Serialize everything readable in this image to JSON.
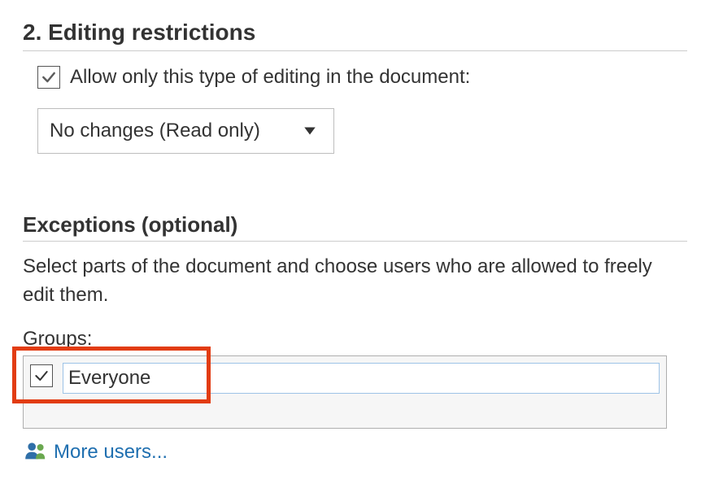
{
  "section": {
    "heading": "2. Editing restrictions",
    "allow_checkbox_label": "Allow only this type of editing in the document:",
    "editing_type_selected": "No changes (Read only)"
  },
  "exceptions": {
    "heading": "Exceptions (optional)",
    "help": "Select parts of the document and choose users who are allowed to freely edit them.",
    "groups_label": "Groups:",
    "group_item": "Everyone",
    "more_users": "More users..."
  }
}
